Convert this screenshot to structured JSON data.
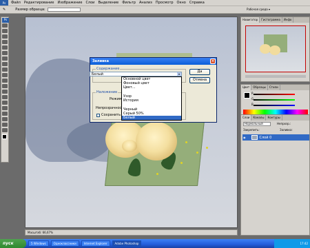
{
  "app": {
    "name": "Ps"
  },
  "menubar": {
    "items": [
      "Файл",
      "Редактирование",
      "Изображение",
      "Слои",
      "Выделение",
      "Фильтр",
      "Анализ",
      "Просмотр",
      "Окно",
      "Справка"
    ]
  },
  "options_bar": {
    "sample_size_label": "Размер образца:",
    "workspace_label": "Рабочая среда ▾"
  },
  "dialog": {
    "title": "Заливка",
    "contents_legend": "Содержание",
    "use_label": "Использовать:",
    "use_value": "Белый",
    "blending_legend": "Наложение",
    "mode_label": "Режим:",
    "opacity_label": "Непрозрачность:",
    "preserve_label": "Сохранить проз",
    "ok_label": "Да",
    "cancel_label": "Отмена",
    "options": [
      "Основной цвет",
      "Фоновый цвет",
      "Цвет...",
      "",
      "Узор",
      "История",
      "",
      "Черный",
      "Серый 50%",
      "Белый"
    ],
    "selected_index": 9
  },
  "panels": {
    "navigator_tabs": [
      "Навигатор",
      "Гистограмма",
      "Инфо"
    ],
    "color_tabs": [
      "Цвет",
      "Образцы",
      "Стили"
    ],
    "layers_tabs": [
      "Слои",
      "Каналы",
      "Контуры"
    ],
    "layers_mode": "Нормальный",
    "layers_opacity_label": "Непрозр.:",
    "layers_lock_label": "Закрепить:",
    "layers_fill_label": "Заливка:",
    "layer_name": "Слой 0",
    "color_channels": [
      "R",
      "G",
      "B"
    ]
  },
  "status": {
    "zoom": "Масштаб: 66,67%"
  },
  "taskbar": {
    "start_label": "пуск",
    "tasks": [
      "5 Windows",
      "Одноклассники",
      "Internet Explorer",
      "Adobe Photoshop"
    ],
    "active_index": 3,
    "clock": "17:42"
  },
  "colors": {
    "accent": "#316ac5",
    "titlebar": "#0a5fd8",
    "taskbar": "#245edb"
  }
}
